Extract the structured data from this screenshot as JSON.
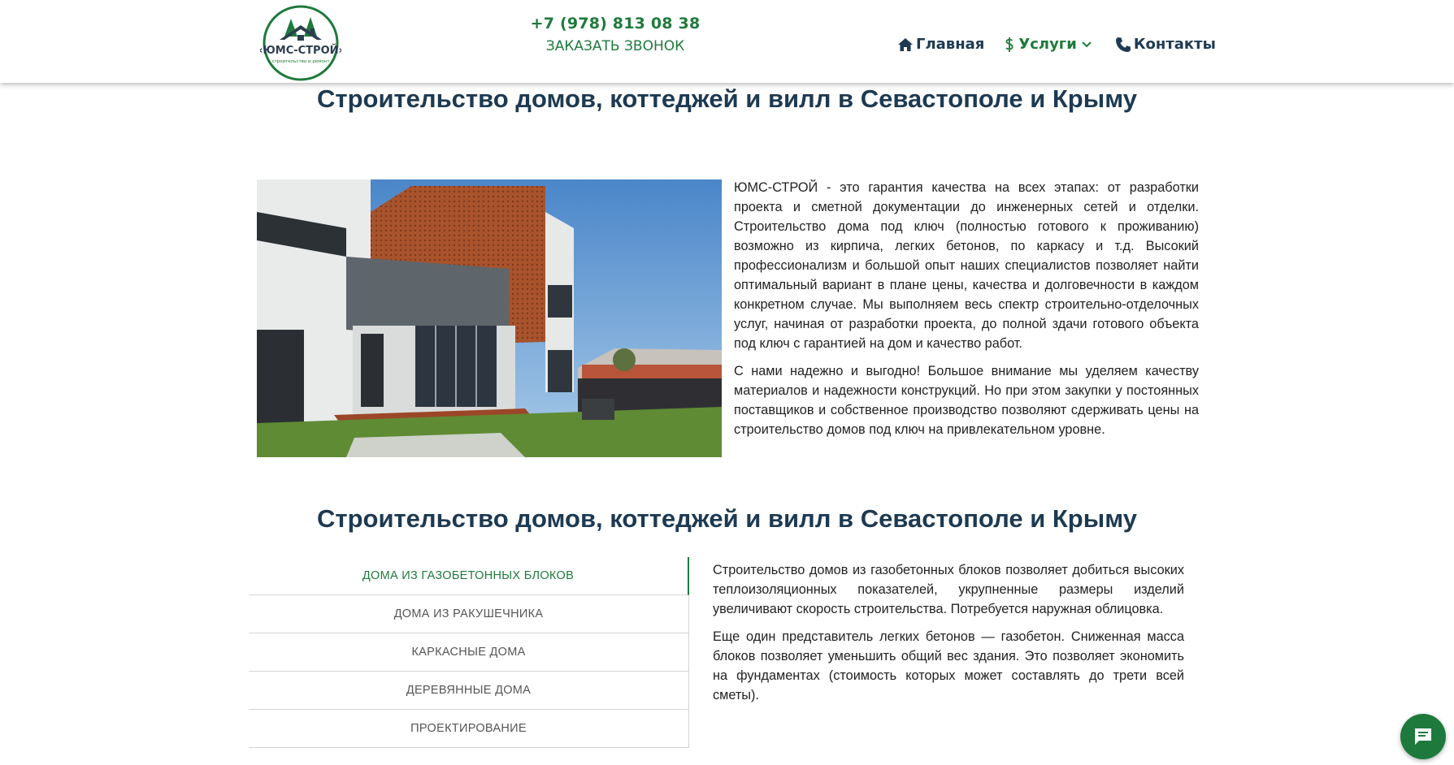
{
  "header": {
    "logo_text": "«ЮМС-СТРОЙ»",
    "logo_subtext": "строительство и ремонт",
    "phone": "+7 (978) 813 08 38",
    "callback_label": "ЗАКАЗАТЬ ЗВОНОК",
    "nav": {
      "home": "Главная",
      "services": "Услуги",
      "contacts": "Контакты"
    }
  },
  "section1": {
    "title": "Строительство домов, коттеджей и вилл в Севастополе и Крыму",
    "paragraphs": [
      "ЮМС-СТРОЙ - это гарантия качества на всех этапах: от разработки проекта и сметной документации до инженерных сетей и отделки. Строительство дома под ключ (полностью готового к проживанию) возможно из кирпича, легких бетонов, по каркасу и т.д. Высокий профессионализм и большой опыт наших специалистов позволяет найти оптимальный вариант в плане цены, качества и долговечности в каждом конкретном случае. Мы выполняем весь спектр строительно-отделочных услуг, начиная от разработки проекта, до полной здачи готового объекта под ключ с гарантией на дом и качество работ.",
      "С нами надежно и выгодно! Большое внимание мы уделяем качеству материалов и надежности конструкций. Но при этом закупки у постоянных поставщиков и собственное производство позволяют сдерживать цены на строительство домов под ключ на привлекательном уровне."
    ]
  },
  "section2": {
    "title": "Строительство домов, коттеджей и вилл в Севастополе и Крыму",
    "tabs": [
      "ДОМА ИЗ ГАЗОБЕТОННЫХ БЛОКОВ",
      "ДОМА ИЗ РАКУШЕЧНИКА",
      "КАРКАСНЫЕ ДОМА",
      "ДЕРЕВЯННЫЕ ДОМА",
      "ПРОЕКТИРОВАНИЕ"
    ],
    "active_tab": 0,
    "tab_paragraphs": [
      "Строительство домов из газобетонных блоков позволяет добиться высоких теплоизоляционных показателей, укрупненные размеры изделий увеличивают скорость строительства. Потребуется наружная облицовка.",
      "Еще один представитель легких бетонов — газобетон. Сниженная масса блоков позволяет уменьшить общий вес здания. Это позволяет экономить на фундаментах (стоимость которых может составлять до трети всей сметы)."
    ]
  },
  "colors": {
    "brand_green": "#1e7a3c",
    "heading_navy": "#1d3a52"
  },
  "icons": [
    "home-icon",
    "dollar-icon",
    "chevron-down-icon",
    "phone-icon",
    "chat-icon"
  ]
}
